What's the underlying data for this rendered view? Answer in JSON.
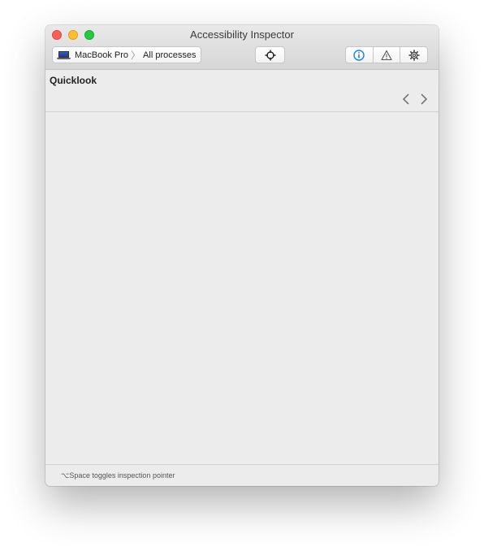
{
  "window": {
    "title": "Accessibility Inspector"
  },
  "toolbar": {
    "device": "MacBook Pro",
    "process": "All processes",
    "device_icon": "laptop-icon",
    "pointer_icon": "crosshair-icon",
    "segments": [
      {
        "icon": "info-icon",
        "selected": true,
        "accent": "#1a7ef5"
      },
      {
        "icon": "warning-icon",
        "selected": false
      },
      {
        "icon": "gear-icon",
        "selected": false
      }
    ]
  },
  "inspector": {
    "section_title": "Quicklook",
    "back_icon": "chevron-left-icon",
    "forward_icon": "chevron-right-icon"
  },
  "status_bar": {
    "hint": "⌥Space toggles inspection pointer"
  }
}
